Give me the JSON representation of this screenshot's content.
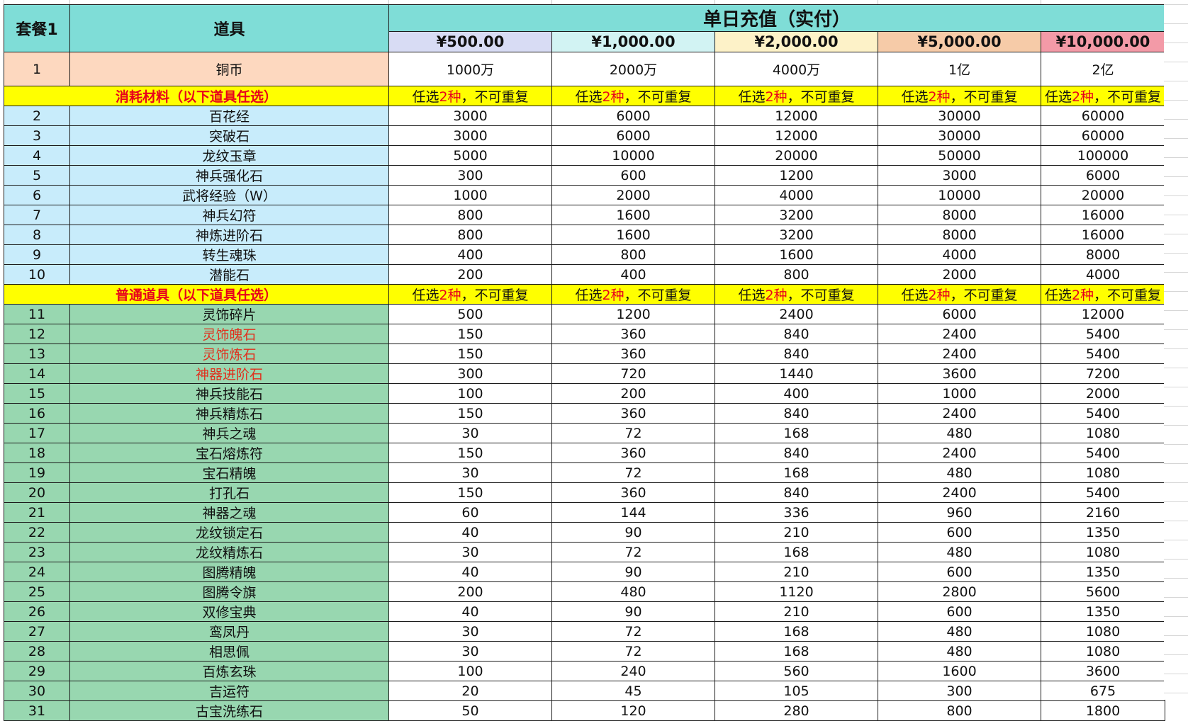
{
  "header": {
    "package": "套餐1",
    "item": "道具",
    "title": "单日充值（实付）",
    "prices": [
      "¥500.00",
      "¥1,000.00",
      "¥2,000.00",
      "¥5,000.00",
      "¥10,000.00"
    ]
  },
  "coin_row": {
    "no": "1",
    "name": "铜币",
    "values": [
      "1000万",
      "2000万",
      "4000万",
      "1亿",
      "2亿"
    ]
  },
  "section_consumable": {
    "label": "消耗材料（以下道具任选）",
    "pick_pre": "任选",
    "pick_num": "2种",
    "pick_post": "，不可重复"
  },
  "consumables": [
    {
      "no": "2",
      "name": "百花经",
      "values": [
        "3000",
        "6000",
        "12000",
        "30000",
        "60000"
      ]
    },
    {
      "no": "3",
      "name": "突破石",
      "values": [
        "3000",
        "6000",
        "12000",
        "30000",
        "60000"
      ]
    },
    {
      "no": "4",
      "name": "龙纹玉章",
      "values": [
        "5000",
        "10000",
        "20000",
        "50000",
        "100000"
      ]
    },
    {
      "no": "5",
      "name": "神兵强化石",
      "values": [
        "300",
        "600",
        "1200",
        "3000",
        "6000"
      ]
    },
    {
      "no": "6",
      "name": "武将经验（W）",
      "values": [
        "1000",
        "2000",
        "4000",
        "10000",
        "20000"
      ]
    },
    {
      "no": "7",
      "name": "神兵幻符",
      "values": [
        "800",
        "1600",
        "3200",
        "8000",
        "16000"
      ]
    },
    {
      "no": "8",
      "name": "神炼进阶石",
      "values": [
        "800",
        "1600",
        "3200",
        "8000",
        "16000"
      ]
    },
    {
      "no": "9",
      "name": "转生魂珠",
      "values": [
        "400",
        "800",
        "1600",
        "4000",
        "8000"
      ]
    },
    {
      "no": "10",
      "name": "潜能石",
      "values": [
        "200",
        "400",
        "800",
        "2000",
        "4000"
      ]
    }
  ],
  "section_common": {
    "label": "普通道具（以下道具任选）",
    "pick_pre": "任选",
    "pick_num": "2种",
    "pick_post": "，不可重复"
  },
  "common": [
    {
      "no": "11",
      "name": "灵饰碎片",
      "red": false,
      "values": [
        "500",
        "1200",
        "2400",
        "6000",
        "12000"
      ]
    },
    {
      "no": "12",
      "name": "灵饰魄石",
      "red": true,
      "values": [
        "150",
        "360",
        "840",
        "2400",
        "5400"
      ]
    },
    {
      "no": "13",
      "name": "灵饰炼石",
      "red": true,
      "values": [
        "150",
        "360",
        "840",
        "2400",
        "5400"
      ]
    },
    {
      "no": "14",
      "name": "神器进阶石",
      "red": true,
      "values": [
        "300",
        "720",
        "1440",
        "3600",
        "7200"
      ]
    },
    {
      "no": "15",
      "name": "神兵技能石",
      "red": false,
      "values": [
        "100",
        "200",
        "400",
        "1000",
        "2000"
      ]
    },
    {
      "no": "16",
      "name": "神兵精炼石",
      "red": false,
      "values": [
        "150",
        "360",
        "840",
        "2400",
        "5400"
      ]
    },
    {
      "no": "17",
      "name": "神兵之魂",
      "red": false,
      "values": [
        "30",
        "72",
        "168",
        "480",
        "1080"
      ]
    },
    {
      "no": "18",
      "name": "宝石熔炼符",
      "red": false,
      "values": [
        "150",
        "360",
        "840",
        "2400",
        "5400"
      ]
    },
    {
      "no": "19",
      "name": "宝石精魄",
      "red": false,
      "values": [
        "30",
        "72",
        "168",
        "480",
        "1080"
      ]
    },
    {
      "no": "20",
      "name": "打孔石",
      "red": false,
      "values": [
        "150",
        "360",
        "840",
        "2400",
        "5400"
      ]
    },
    {
      "no": "21",
      "name": "神器之魂",
      "red": false,
      "values": [
        "60",
        "144",
        "336",
        "960",
        "2160"
      ]
    },
    {
      "no": "22",
      "name": "龙纹锁定石",
      "red": false,
      "values": [
        "40",
        "90",
        "210",
        "600",
        "1350"
      ]
    },
    {
      "no": "23",
      "name": "龙纹精炼石",
      "red": false,
      "values": [
        "30",
        "72",
        "168",
        "480",
        "1080"
      ]
    },
    {
      "no": "24",
      "name": "图腾精魄",
      "red": false,
      "values": [
        "40",
        "90",
        "210",
        "600",
        "1350"
      ]
    },
    {
      "no": "25",
      "name": "图腾令旗",
      "red": false,
      "values": [
        "200",
        "480",
        "1120",
        "2800",
        "5600"
      ]
    },
    {
      "no": "26",
      "name": "双修宝典",
      "red": false,
      "values": [
        "40",
        "90",
        "210",
        "600",
        "1350"
      ]
    },
    {
      "no": "27",
      "name": "鸾凤丹",
      "red": false,
      "values": [
        "30",
        "72",
        "168",
        "480",
        "1080"
      ]
    },
    {
      "no": "28",
      "name": "相思佩",
      "red": false,
      "values": [
        "30",
        "72",
        "168",
        "480",
        "1080"
      ]
    },
    {
      "no": "29",
      "name": "百炼玄珠",
      "red": false,
      "values": [
        "100",
        "240",
        "560",
        "1600",
        "3600"
      ]
    },
    {
      "no": "30",
      "name": "吉运符",
      "red": false,
      "values": [
        "20",
        "45",
        "105",
        "300",
        "675"
      ]
    },
    {
      "no": "31",
      "name": "古宝洗练石",
      "red": false,
      "values": [
        "50",
        "120",
        "280",
        "800",
        "1800"
      ]
    }
  ]
}
